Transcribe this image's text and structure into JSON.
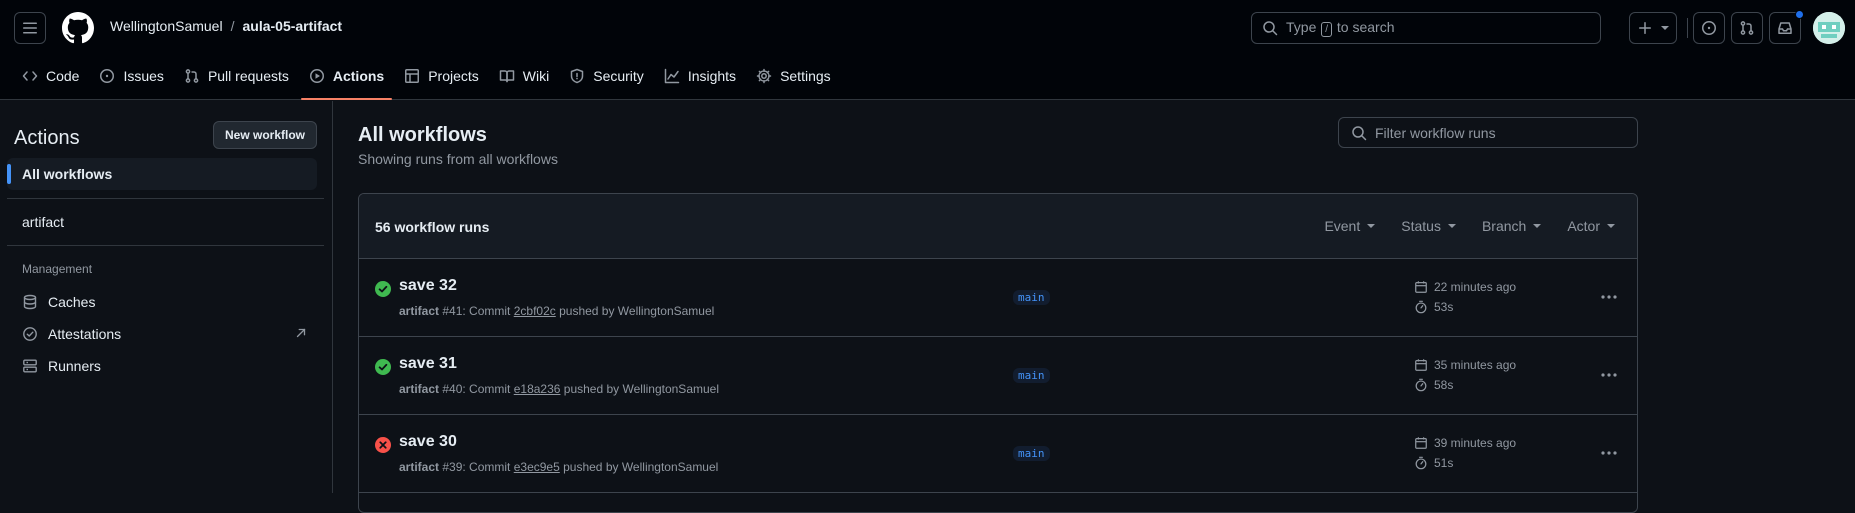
{
  "colors": {
    "accent": "#f78166",
    "link": "#4493f8",
    "success": "#3fb950",
    "failure": "#f85149",
    "bg": "#0d1117",
    "header_bg": "#010409"
  },
  "header": {
    "owner": "WellingtonSamuel",
    "separator": "/",
    "repo": "aula-05-artifact",
    "search": {
      "prefix": "Type",
      "key": "/",
      "suffix": "to search"
    }
  },
  "tabs": [
    {
      "label": "Code",
      "icon": "code-icon"
    },
    {
      "label": "Issues",
      "icon": "issue-opened-icon"
    },
    {
      "label": "Pull requests",
      "icon": "git-pull-request-icon"
    },
    {
      "label": "Actions",
      "icon": "play-icon",
      "active": true
    },
    {
      "label": "Projects",
      "icon": "table-icon"
    },
    {
      "label": "Wiki",
      "icon": "book-icon"
    },
    {
      "label": "Security",
      "icon": "shield-icon"
    },
    {
      "label": "Insights",
      "icon": "graph-icon"
    },
    {
      "label": "Settings",
      "icon": "gear-icon"
    }
  ],
  "sidebar": {
    "title": "Actions",
    "new_workflow": "New workflow",
    "all_workflows": "All workflows",
    "workflows": [
      "artifact"
    ],
    "management_heading": "Management",
    "management": [
      {
        "label": "Caches",
        "icon": "database-icon"
      },
      {
        "label": "Attestations",
        "icon": "verified-icon"
      },
      {
        "label": "Runners",
        "icon": "server-icon"
      }
    ]
  },
  "main": {
    "title": "All workflows",
    "subtitle": "Showing runs from all workflows",
    "filter_placeholder": "Filter workflow runs",
    "runs_count": "56 workflow runs",
    "filters": [
      "Event",
      "Status",
      "Branch",
      "Actor"
    ],
    "runs": [
      {
        "status": "success",
        "title": "save 32",
        "workflow": "artifact",
        "number": "#41",
        "commit_prefix": ": Commit ",
        "sha": "2cbf02c",
        "pushed_by": " pushed by WellingtonSamuel",
        "branch": "main",
        "when": "22 minutes ago",
        "duration": "53s"
      },
      {
        "status": "success",
        "title": "save 31",
        "workflow": "artifact",
        "number": "#40",
        "commit_prefix": ": Commit ",
        "sha": "e18a236",
        "pushed_by": " pushed by WellingtonSamuel",
        "branch": "main",
        "when": "35 minutes ago",
        "duration": "58s"
      },
      {
        "status": "failure",
        "title": "save 30",
        "workflow": "artifact",
        "number": "#39",
        "commit_prefix": ": Commit ",
        "sha": "e3ec9e5",
        "pushed_by": " pushed by WellingtonSamuel",
        "branch": "main",
        "when": "39 minutes ago",
        "duration": "51s"
      }
    ]
  }
}
